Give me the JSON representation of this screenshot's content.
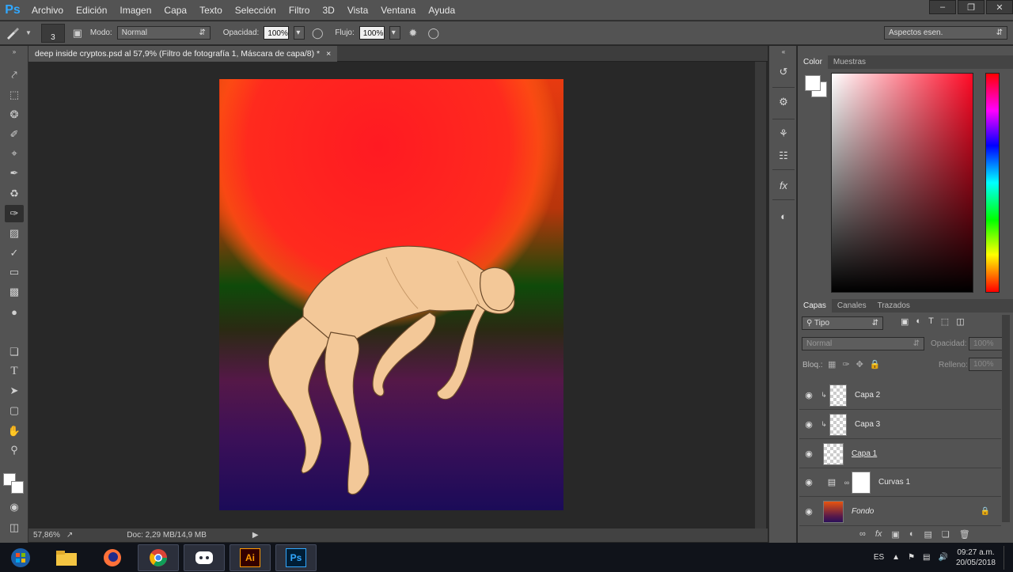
{
  "app": {
    "logo": "Ps",
    "name": "Adobe Photoshop"
  },
  "menu": [
    "Archivo",
    "Edición",
    "Imagen",
    "Capa",
    "Texto",
    "Selección",
    "Filtro",
    "3D",
    "Vista",
    "Ventana",
    "Ayuda"
  ],
  "options": {
    "brush_size": "3",
    "mode_label": "Modo:",
    "mode_value": "Normal",
    "opacity_label": "Opacidad:",
    "opacity_value": "100%",
    "flow_label": "Flujo:",
    "flow_value": "100%",
    "workspace": "Aspectos esen."
  },
  "document": {
    "tab_title": "deep inside cryptos.psd al 57,9% (Filtro de fotografía 1, Máscara de capa/8) *",
    "close": "×"
  },
  "status": {
    "zoom": "57,86%",
    "doc_info": "Doc: 2,29 MB/14,9 MB"
  },
  "color_panel": {
    "tabs": [
      "Color",
      "Muestras"
    ],
    "active_tab": "Color"
  },
  "layers_panel": {
    "tabs": [
      "Capas",
      "Canales",
      "Trazados"
    ],
    "filter_label": "Tipo",
    "blend_mode": "Normal",
    "opacity_label": "Opacidad:",
    "opacity_value": "100%",
    "lock_label": "Bloq.:",
    "fill_label": "Relleno:",
    "fill_value": "100%",
    "layers": [
      {
        "name": "Capa 2",
        "type": "clipped"
      },
      {
        "name": "Capa 3",
        "type": "clipped"
      },
      {
        "name": "Capa 1",
        "type": "normal"
      },
      {
        "name": "Curvas 1",
        "type": "adjustment"
      },
      {
        "name": "Fondo",
        "type": "background"
      }
    ]
  },
  "taskbar": {
    "language": "ES",
    "time": "09:27 a.m.",
    "date": "20/05/2018",
    "apps": [
      "windows-start",
      "file-explorer",
      "firefox",
      "chrome",
      "discord",
      "illustrator",
      "photoshop"
    ]
  },
  "colors": {
    "accent": "#31a8ff",
    "panel": "#535353",
    "canvas": "#282828"
  }
}
